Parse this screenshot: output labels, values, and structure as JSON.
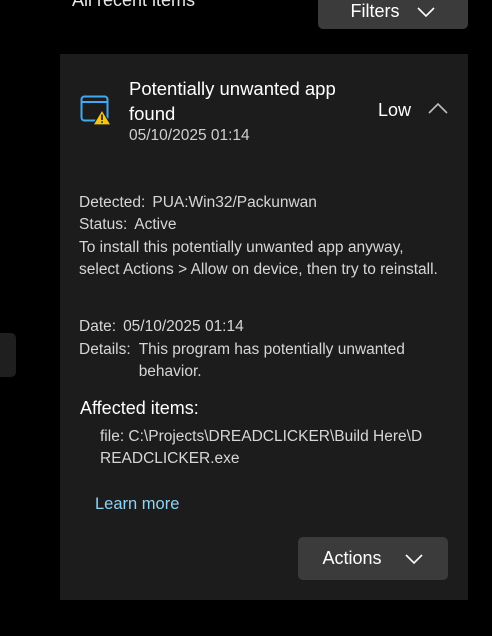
{
  "header": {
    "recent_label": "All recent items",
    "filters_label": "Filters"
  },
  "threat": {
    "title": "Potentially unwanted app found",
    "timestamp": "05/10/2025 01:14",
    "severity": "Low",
    "detected_label": "Detected:",
    "detected_value": "PUA:Win32/Packunwan",
    "status_label": "Status:",
    "status_value": "Active",
    "instructions": "To install this potentially unwanted app anyway, select Actions > Allow on device, then try to reinstall.",
    "date_label": "Date:",
    "date_value": "05/10/2025 01:14",
    "details_label": "Details:",
    "details_value": "This program has potentially unwanted behavior.",
    "affected_title": "Affected items:",
    "affected_file": "file: C:\\Projects\\DREADCLICKER\\Build Here\\DREADCLICKER.exe",
    "learn_more": "Learn more",
    "actions_label": "Actions"
  },
  "icons": {
    "app": "app-window-warning-icon",
    "collapse": "chevron-up-icon",
    "dropdown": "chevron-down-icon"
  },
  "colors": {
    "background": "#000000",
    "card": "#1c1c1c",
    "button": "#3b3b3b",
    "link": "#8ed2f5",
    "icon_blue": "#3fa9f5",
    "warning": "#f5c518"
  }
}
